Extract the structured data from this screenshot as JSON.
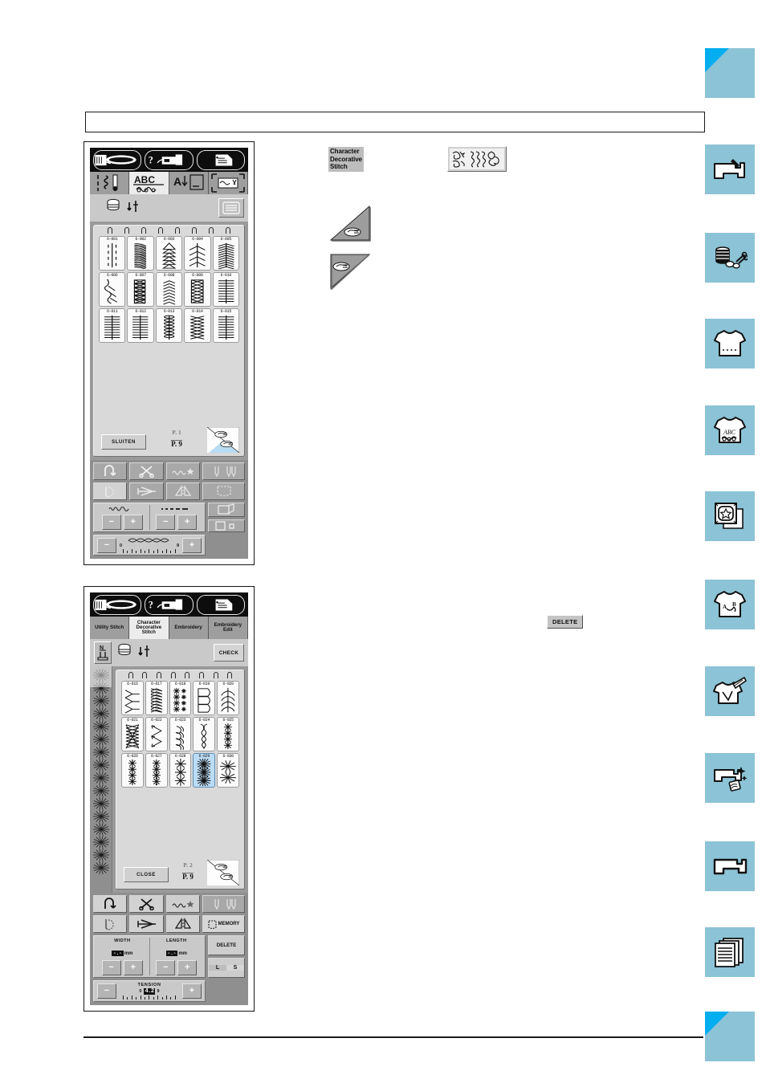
{
  "page": {
    "header_bar": "",
    "footer_rule": ""
  },
  "screen1": {
    "name": "Character Decorative Stitch selection screen (page 1)",
    "titlebar_buttons": [
      {
        "name": "needle-threader-icon",
        "label": ""
      },
      {
        "name": "machine-help-icon",
        "label": ""
      },
      {
        "name": "settings-list-icon",
        "label": ""
      }
    ],
    "tabs": [
      {
        "name": "tab-utility-stitch",
        "label": "",
        "icon": "utility-stitch-icon",
        "active": false
      },
      {
        "name": "tab-character-decorative-stitch",
        "label": "",
        "icon": "abc-decorative-icon",
        "active": true
      },
      {
        "name": "tab-embroidery",
        "label": "",
        "icon": "embroidery-icon",
        "active": false
      },
      {
        "name": "tab-embroidery-edit",
        "label": "",
        "icon": "embroidery-edit-icon",
        "active": false
      }
    ],
    "utilbar": {
      "bobbin_icon": "bobbin-winding-icon",
      "needle_icon": "needle-position-icon",
      "menu_button": "menu-list-button"
    },
    "stitches": [
      {
        "code": "6-001",
        "art": "dashed-line"
      },
      {
        "code": "6-002",
        "art": "rope-twist"
      },
      {
        "code": "6-003",
        "art": "triangle-stack"
      },
      {
        "code": "6-004",
        "art": "sparse-fern"
      },
      {
        "code": "6-005",
        "art": "dense-fern"
      },
      {
        "code": "6-006",
        "art": "wave-peaks"
      },
      {
        "code": "6-007",
        "art": "crossed-boxes"
      },
      {
        "code": "6-008",
        "art": "chevron-chain"
      },
      {
        "code": "6-009",
        "art": "ladder-cross"
      },
      {
        "code": "6-010",
        "art": "comb-ladder"
      },
      {
        "code": "6-011",
        "art": "comb-ladder"
      },
      {
        "code": "6-012",
        "art": "comb-ladder"
      },
      {
        "code": "6-013",
        "art": "beaded-spine"
      },
      {
        "code": "6-014",
        "art": "lattice-cross"
      },
      {
        "code": "6-015",
        "art": "comb-ladder"
      }
    ],
    "footer": {
      "close_label": "SLUITEN",
      "page_current": "P. 1",
      "page_total": "P. 9",
      "corner_name": "page-turn-corner"
    },
    "deck": {
      "row1": [
        {
          "name": "reverse-stitch-button",
          "state": "off"
        },
        {
          "name": "thread-cutter-button",
          "state": "off"
        },
        {
          "name": "stitch-star-button",
          "state": "off"
        },
        {
          "name": "needle-mode-button",
          "state": "off"
        }
      ],
      "row2": [
        {
          "name": "needle-thread-button",
          "state": "on"
        },
        {
          "name": "mirror-image-button",
          "state": "off"
        },
        {
          "name": "taper-button",
          "state": "off"
        },
        {
          "name": "pocket-memory-button",
          "state": "off"
        }
      ],
      "width": {
        "label": "",
        "value": ""
      },
      "length": {
        "label": "",
        "value": ""
      },
      "minus_label": "−",
      "plus_label": "+",
      "tension": {
        "label": "",
        "min": "0",
        "max": "9",
        "value": ""
      },
      "side_buttons": [
        {
          "name": "stitch-preview-button",
          "label": ""
        },
        {
          "name": "size-select-button",
          "label": ""
        }
      ]
    }
  },
  "screen2": {
    "name": "Character Decorative Stitch selection screen (page 2)",
    "titlebar_buttons": [
      {
        "name": "needle-threader-icon",
        "label": ""
      },
      {
        "name": "machine-help-icon",
        "label": ""
      },
      {
        "name": "settings-list-icon",
        "label": ""
      }
    ],
    "tabs": [
      {
        "name": "tab-utility-stitch",
        "label": "Utility Stitch",
        "active": false
      },
      {
        "name": "tab-character-decorative-stitch",
        "label": "Character Decorative Stitch",
        "active": true
      },
      {
        "name": "tab-embroidery",
        "label": "Embroidery",
        "active": false
      },
      {
        "name": "tab-embroidery-edit",
        "label": "Embroidery Edit",
        "active": false
      }
    ],
    "utilbar": {
      "presser_foot_icon": "presser-foot-n-icon",
      "bobbin_icon": "bobbin-winding-icon",
      "needle_icon": "needle-position-icon",
      "check_label": "CHECK"
    },
    "preview_rail": {
      "name": "selected-stitch-preview-rail"
    },
    "stitches": [
      {
        "code": "6-016",
        "art": "branch-y"
      },
      {
        "code": "6-017",
        "art": "arrow-chain"
      },
      {
        "code": "6-018",
        "art": "star-column"
      },
      {
        "code": "6-019",
        "art": "loop-boxes"
      },
      {
        "code": "6-020",
        "art": "leaf-spray"
      },
      {
        "code": "6-021",
        "art": "zig-lattice"
      },
      {
        "code": "6-022",
        "art": "arrow-zigzag"
      },
      {
        "code": "6-023",
        "art": "feather-drift"
      },
      {
        "code": "6-024",
        "art": "vine-column"
      },
      {
        "code": "6-025",
        "art": "asterisk-column"
      },
      {
        "code": "6-026",
        "art": "asterisk-column"
      },
      {
        "code": "6-027",
        "art": "asterisk-dot-column"
      },
      {
        "code": "6-028",
        "art": "snowflake-pair"
      },
      {
        "code": "6-029",
        "art": "burst-column",
        "selected": true
      },
      {
        "code": "6-030",
        "art": "double-snowflake"
      }
    ],
    "footer": {
      "close_label": "CLOSE",
      "page_current": "P. 2",
      "page_total": "P. 9",
      "corner_name": "page-turn-corner"
    },
    "deck": {
      "row1": [
        {
          "name": "reverse-stitch-button",
          "state": "on"
        },
        {
          "name": "thread-cutter-button",
          "state": "on"
        },
        {
          "name": "stitch-star-button",
          "state": "lit"
        },
        {
          "name": "needle-mode-button",
          "state": "off"
        }
      ],
      "row2": [
        {
          "name": "needle-thread-button",
          "state": "lit"
        },
        {
          "name": "mirror-image-button",
          "state": "on"
        },
        {
          "name": "taper-button",
          "state": "on"
        },
        {
          "name": "memory-button",
          "state": "on",
          "label": "MEMORY"
        }
      ],
      "width": {
        "label": "WIDTH",
        "unit": "mm",
        "value": "-.-"
      },
      "length": {
        "label": "LENGTH",
        "unit": "mm",
        "value": "-.-"
      },
      "minus_label": "−",
      "plus_label": "+",
      "tension": {
        "label": "TENSION",
        "min": "0",
        "max": "9",
        "value": "4.2"
      },
      "side_buttons": [
        {
          "name": "delete-button",
          "label": "DELETE"
        },
        {
          "name": "size-l-s-button",
          "label_l": "L",
          "label_s": "S"
        }
      ]
    }
  },
  "callouts": [
    {
      "name": "callout-character-decorative-stitch-tab",
      "type": "chip",
      "text": "Character\nDecorative\nStitch"
    },
    {
      "name": "callout-decorative-stitch-icon-button",
      "type": "icon-chip",
      "icon": "decorative-stitch-samples-icon"
    },
    {
      "name": "callout-page-forward-corner",
      "type": "corner",
      "icon": "page-forward-corner-icon"
    },
    {
      "name": "callout-page-back-corner",
      "type": "corner",
      "icon": "page-back-corner-icon"
    },
    {
      "name": "callout-delete-button",
      "type": "delete-chip",
      "text": "DELETE"
    }
  ],
  "sidebar": {
    "accent_cyan": "#02aeef",
    "tab_blue": "#8cc3d6",
    "items": [
      {
        "name": "sidebar-tab-cover",
        "icon": "blank-corner-icon",
        "corner": true
      },
      {
        "name": "sidebar-tab-machine-setup",
        "icon": "sewing-machine-icon"
      },
      {
        "name": "sidebar-tab-sewing-basics",
        "icon": "spool-scissors-icon"
      },
      {
        "name": "sidebar-tab-utility-stitches",
        "icon": "shirt-stitch-icon"
      },
      {
        "name": "sidebar-tab-character-decorative",
        "icon": "shirt-abc-icon"
      },
      {
        "name": "sidebar-tab-embroidery",
        "icon": "hoop-star-icon"
      },
      {
        "name": "sidebar-tab-embroidery-edit",
        "icon": "shirt-ab-icon"
      },
      {
        "name": "sidebar-tab-my-custom-stitch",
        "icon": "shirt-pen-icon"
      },
      {
        "name": "sidebar-tab-appendix-care",
        "icon": "machine-sparkle-icon"
      },
      {
        "name": "sidebar-tab-machine-settings",
        "icon": "machine-plain-icon"
      },
      {
        "name": "sidebar-tab-index",
        "icon": "pages-icon"
      },
      {
        "name": "sidebar-tab-back-cover",
        "icon": "blank-corner-icon",
        "corner": true
      }
    ]
  }
}
